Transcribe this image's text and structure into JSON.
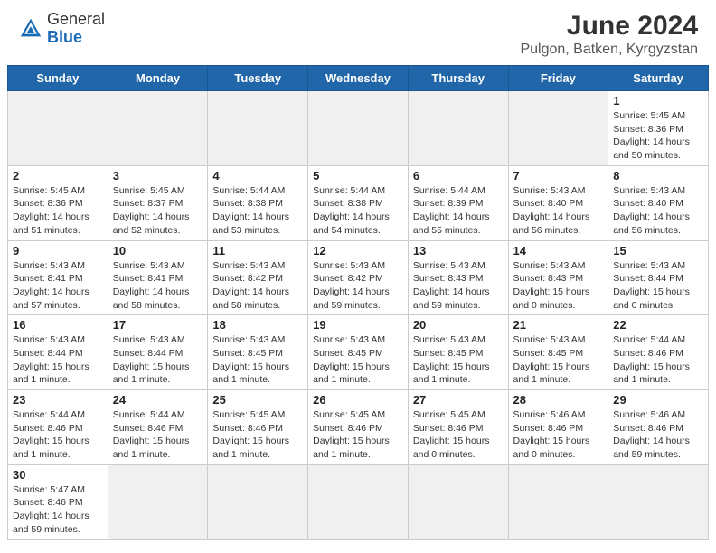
{
  "header": {
    "logo_general": "General",
    "logo_blue": "Blue",
    "title": "June 2024",
    "subtitle": "Pulgon, Batken, Kyrgyzstan"
  },
  "days_of_week": [
    "Sunday",
    "Monday",
    "Tuesday",
    "Wednesday",
    "Thursday",
    "Friday",
    "Saturday"
  ],
  "weeks": [
    [
      {
        "date": "",
        "info": ""
      },
      {
        "date": "",
        "info": ""
      },
      {
        "date": "",
        "info": ""
      },
      {
        "date": "",
        "info": ""
      },
      {
        "date": "",
        "info": ""
      },
      {
        "date": "",
        "info": ""
      },
      {
        "date": "1",
        "info": "Sunrise: 5:45 AM\nSunset: 8:36 PM\nDaylight: 14 hours\nand 50 minutes."
      }
    ],
    [
      {
        "date": "2",
        "info": "Sunrise: 5:45 AM\nSunset: 8:36 PM\nDaylight: 14 hours\nand 51 minutes."
      },
      {
        "date": "3",
        "info": "Sunrise: 5:45 AM\nSunset: 8:37 PM\nDaylight: 14 hours\nand 52 minutes."
      },
      {
        "date": "4",
        "info": "Sunrise: 5:44 AM\nSunset: 8:38 PM\nDaylight: 14 hours\nand 53 minutes."
      },
      {
        "date": "5",
        "info": "Sunrise: 5:44 AM\nSunset: 8:38 PM\nDaylight: 14 hours\nand 54 minutes."
      },
      {
        "date": "6",
        "info": "Sunrise: 5:44 AM\nSunset: 8:39 PM\nDaylight: 14 hours\nand 55 minutes."
      },
      {
        "date": "7",
        "info": "Sunrise: 5:43 AM\nSunset: 8:40 PM\nDaylight: 14 hours\nand 56 minutes."
      },
      {
        "date": "8",
        "info": "Sunrise: 5:43 AM\nSunset: 8:40 PM\nDaylight: 14 hours\nand 56 minutes."
      }
    ],
    [
      {
        "date": "9",
        "info": "Sunrise: 5:43 AM\nSunset: 8:41 PM\nDaylight: 14 hours\nand 57 minutes."
      },
      {
        "date": "10",
        "info": "Sunrise: 5:43 AM\nSunset: 8:41 PM\nDaylight: 14 hours\nand 58 minutes."
      },
      {
        "date": "11",
        "info": "Sunrise: 5:43 AM\nSunset: 8:42 PM\nDaylight: 14 hours\nand 58 minutes."
      },
      {
        "date": "12",
        "info": "Sunrise: 5:43 AM\nSunset: 8:42 PM\nDaylight: 14 hours\nand 59 minutes."
      },
      {
        "date": "13",
        "info": "Sunrise: 5:43 AM\nSunset: 8:43 PM\nDaylight: 14 hours\nand 59 minutes."
      },
      {
        "date": "14",
        "info": "Sunrise: 5:43 AM\nSunset: 8:43 PM\nDaylight: 15 hours\nand 0 minutes."
      },
      {
        "date": "15",
        "info": "Sunrise: 5:43 AM\nSunset: 8:44 PM\nDaylight: 15 hours\nand 0 minutes."
      }
    ],
    [
      {
        "date": "16",
        "info": "Sunrise: 5:43 AM\nSunset: 8:44 PM\nDaylight: 15 hours\nand 1 minute."
      },
      {
        "date": "17",
        "info": "Sunrise: 5:43 AM\nSunset: 8:44 PM\nDaylight: 15 hours\nand 1 minute."
      },
      {
        "date": "18",
        "info": "Sunrise: 5:43 AM\nSunset: 8:45 PM\nDaylight: 15 hours\nand 1 minute."
      },
      {
        "date": "19",
        "info": "Sunrise: 5:43 AM\nSunset: 8:45 PM\nDaylight: 15 hours\nand 1 minute."
      },
      {
        "date": "20",
        "info": "Sunrise: 5:43 AM\nSunset: 8:45 PM\nDaylight: 15 hours\nand 1 minute."
      },
      {
        "date": "21",
        "info": "Sunrise: 5:43 AM\nSunset: 8:45 PM\nDaylight: 15 hours\nand 1 minute."
      },
      {
        "date": "22",
        "info": "Sunrise: 5:44 AM\nSunset: 8:46 PM\nDaylight: 15 hours\nand 1 minute."
      }
    ],
    [
      {
        "date": "23",
        "info": "Sunrise: 5:44 AM\nSunset: 8:46 PM\nDaylight: 15 hours\nand 1 minute."
      },
      {
        "date": "24",
        "info": "Sunrise: 5:44 AM\nSunset: 8:46 PM\nDaylight: 15 hours\nand 1 minute."
      },
      {
        "date": "25",
        "info": "Sunrise: 5:45 AM\nSunset: 8:46 PM\nDaylight: 15 hours\nand 1 minute."
      },
      {
        "date": "26",
        "info": "Sunrise: 5:45 AM\nSunset: 8:46 PM\nDaylight: 15 hours\nand 1 minute."
      },
      {
        "date": "27",
        "info": "Sunrise: 5:45 AM\nSunset: 8:46 PM\nDaylight: 15 hours\nand 0 minutes."
      },
      {
        "date": "28",
        "info": "Sunrise: 5:46 AM\nSunset: 8:46 PM\nDaylight: 15 hours\nand 0 minutes."
      },
      {
        "date": "29",
        "info": "Sunrise: 5:46 AM\nSunset: 8:46 PM\nDaylight: 14 hours\nand 59 minutes."
      }
    ],
    [
      {
        "date": "30",
        "info": "Sunrise: 5:47 AM\nSunset: 8:46 PM\nDaylight: 14 hours\nand 59 minutes."
      },
      {
        "date": "",
        "info": ""
      },
      {
        "date": "",
        "info": ""
      },
      {
        "date": "",
        "info": ""
      },
      {
        "date": "",
        "info": ""
      },
      {
        "date": "",
        "info": ""
      },
      {
        "date": "",
        "info": ""
      }
    ]
  ]
}
